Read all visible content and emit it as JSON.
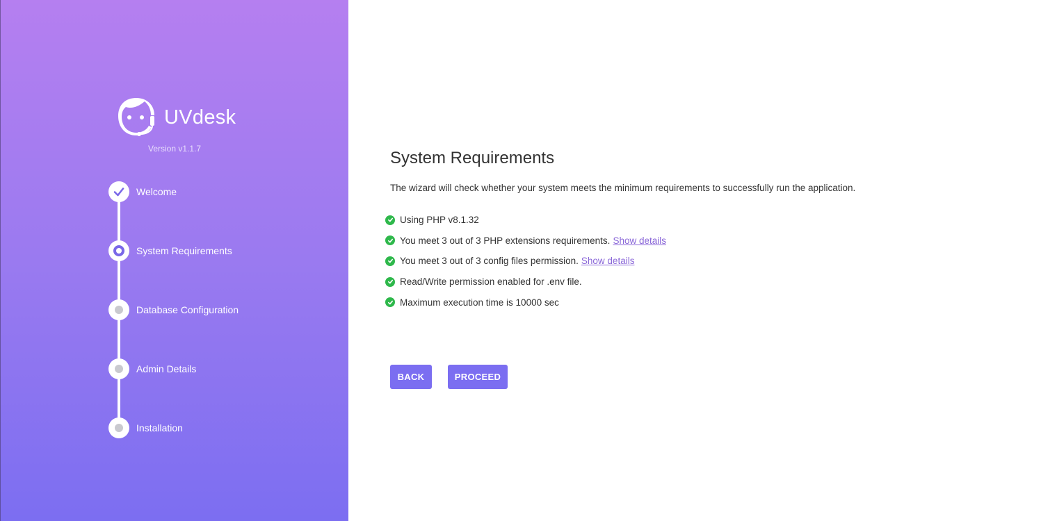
{
  "brand": {
    "name": "UVdesk",
    "version": "Version v1.1.7",
    "logo_icon": "support-agent-icon"
  },
  "steps": [
    {
      "label": "Welcome",
      "state": "done"
    },
    {
      "label": "System Requirements",
      "state": "current"
    },
    {
      "label": "Database Configuration",
      "state": "pending"
    },
    {
      "label": "Admin Details",
      "state": "pending"
    },
    {
      "label": "Installation",
      "state": "pending"
    }
  ],
  "main": {
    "title": "System Requirements",
    "description": "The wizard will check whether your system meets the minimum requirements to successfully run the application.",
    "requirements": [
      {
        "text": "Using PHP v8.1.32",
        "link": ""
      },
      {
        "text": "You meet 3 out of 3 PHP extensions requirements.",
        "link": "Show details"
      },
      {
        "text": "You meet 3 out of 3 config files permission.",
        "link": "Show details"
      },
      {
        "text": "Read/Write permission enabled for .env file.",
        "link": ""
      },
      {
        "text": "Maximum execution time is 10000 sec",
        "link": ""
      }
    ],
    "buttons": {
      "back": "BACK",
      "proceed": "PROCEED"
    }
  },
  "colors": {
    "gradient_top": "#b57ff0",
    "gradient_bottom": "#7c6ef1",
    "accent": "#7b6ef1",
    "success": "#2eb84b",
    "link": "#8a67d8"
  }
}
